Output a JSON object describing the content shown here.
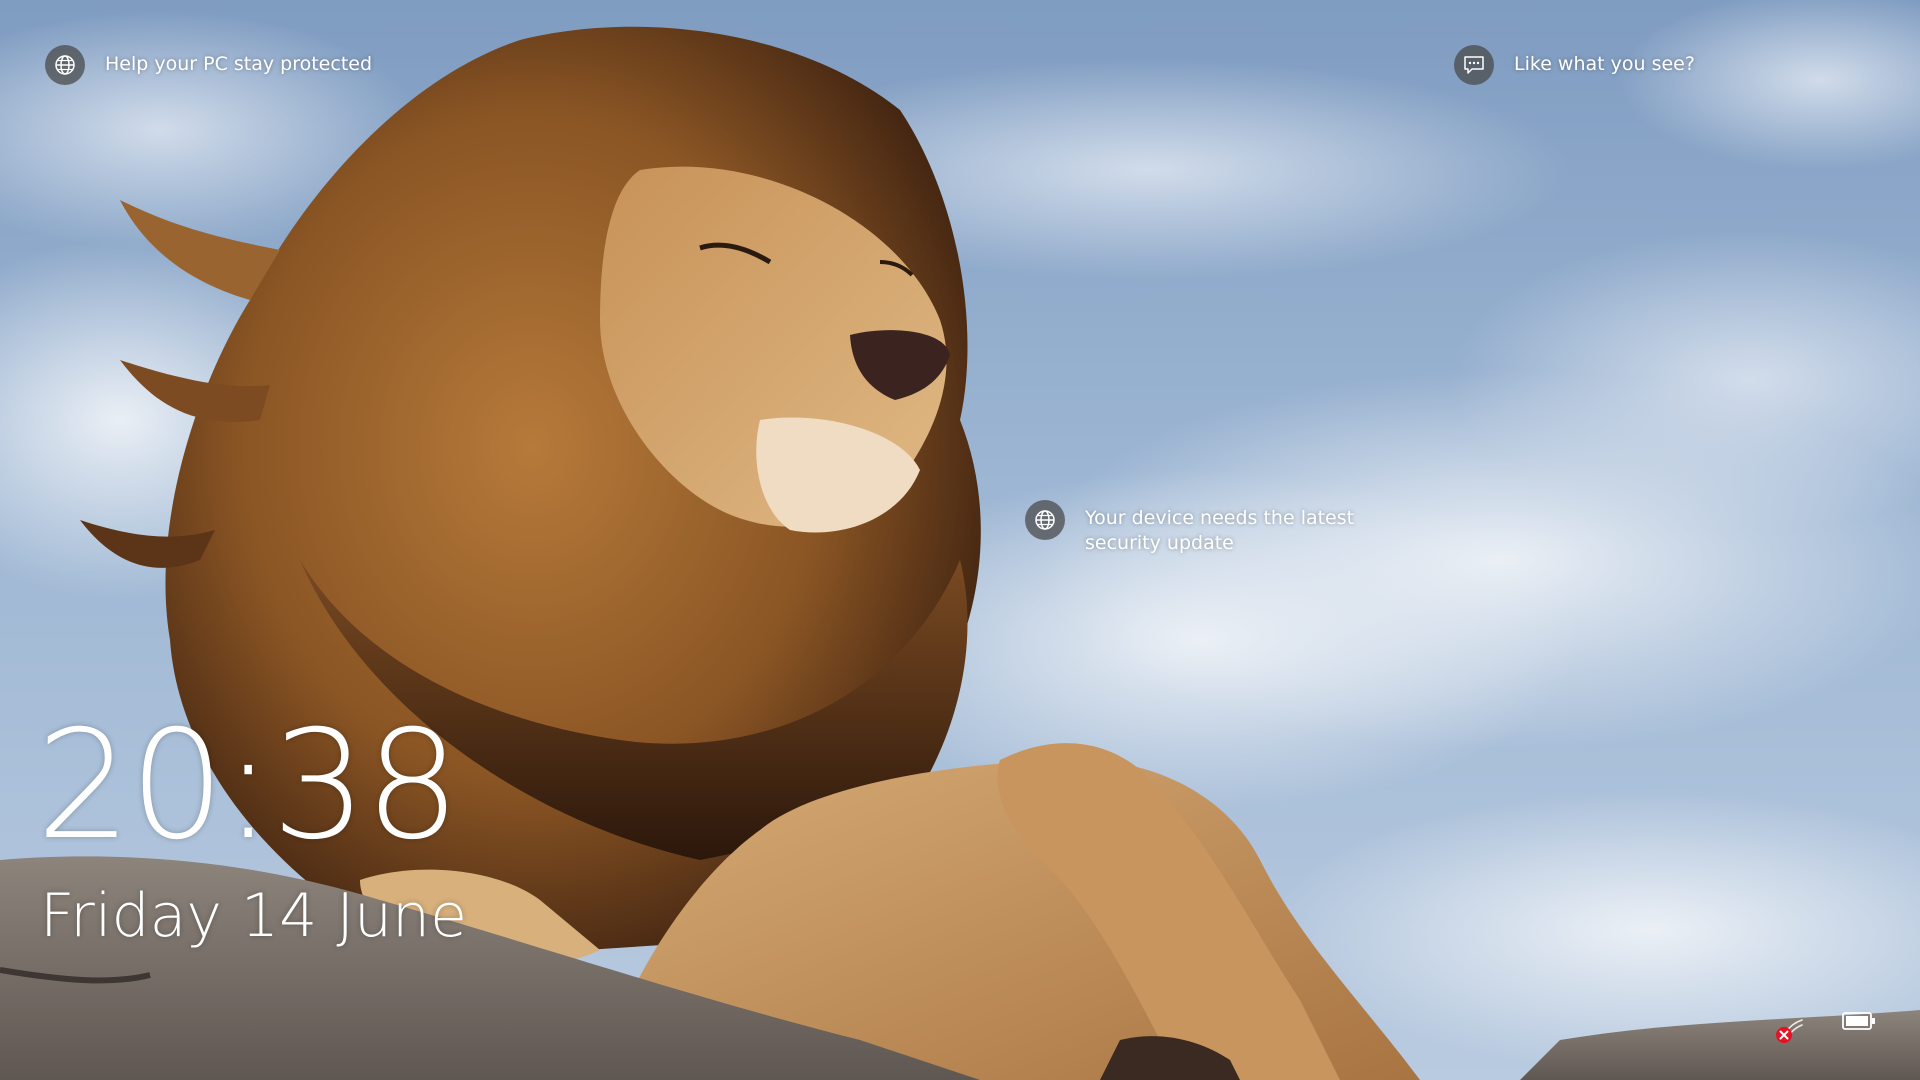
{
  "lock_screen": {
    "spotlight": {
      "protected_tip": "Help your PC stay protected",
      "like_prompt": "Like what you see?",
      "security_update": "Your device needs the latest security update"
    },
    "clock": {
      "time": "20:38",
      "date": "Friday 14 June"
    },
    "status": {
      "network_icon": "network-disconnected-icon",
      "battery_icon": "battery-icon"
    },
    "colors": {
      "text": "#ffffff",
      "icon_circle": "#464646",
      "error_badge": "#e81123"
    }
  }
}
